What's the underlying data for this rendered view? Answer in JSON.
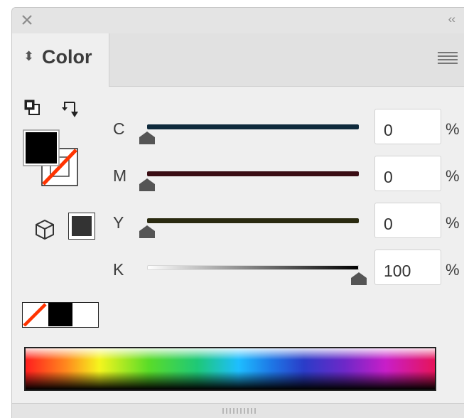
{
  "panel": {
    "tab_arrows": "⬍",
    "tab_label": "Color",
    "collapse_glyph": "‹‹"
  },
  "channels": [
    {
      "label": "C",
      "value": "0",
      "unit": "%",
      "level": 0,
      "track_color": "#0e2a3c"
    },
    {
      "label": "M",
      "value": "0",
      "unit": "%",
      "level": 0,
      "track_color": "#3a0d14"
    },
    {
      "label": "Y",
      "value": "0",
      "unit": "%",
      "level": 0,
      "track_color": "#2a2a10"
    },
    {
      "label": "K",
      "value": "100",
      "unit": "%",
      "level": 100,
      "track_color": "gradient-white-to-black"
    }
  ],
  "swatches": {
    "fill_color": "#000000",
    "stroke": "none",
    "out_of_gamut_color": "#333333",
    "quick": [
      "none",
      "#000000",
      "#ffffff"
    ]
  },
  "icons": {
    "close": "close-icon",
    "collapse": "collapse-icon",
    "panel_menu": "panel-menu-icon",
    "default_colors": "default-fill-stroke-icon",
    "swap": "swap-fill-stroke-icon",
    "out_of_gamut": "out-of-gamut-cube-icon",
    "none_slash_color": "#ff3300"
  }
}
